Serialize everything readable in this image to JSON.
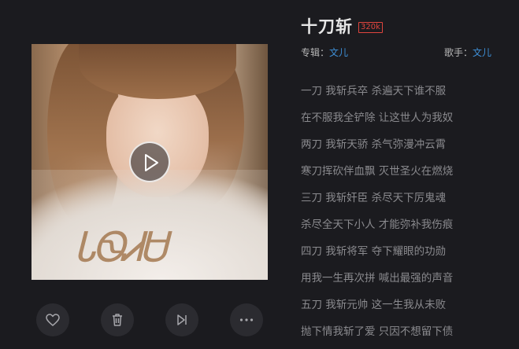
{
  "song": {
    "title": "十刀斩",
    "quality_badge": "320k",
    "album_label": "专辑：",
    "album": "文儿",
    "artist_label": "歌手：",
    "artist": "文儿"
  },
  "lyrics": [
    "一刀 我斩兵卒 杀遍天下谁不服",
    "在不服我全铲除 让这世人为我奴",
    "两刀 我斩天骄 杀气弥漫冲云霄",
    "寒刀挥砍伴血飘 灭世圣火在燃烧",
    "三刀 我斩奸臣 杀尽天下厉鬼魂",
    "杀尽全天下小人 才能弥补我伤痕",
    "四刀 我斩将军 夺下耀眼的功勋",
    "用我一生再次拼 喊出最强的声音",
    "五刀 我斩元帅 这一生我从未败",
    "抛下情我斩了爱 只因不想留下债"
  ],
  "controls": {
    "like_icon": "heart-icon",
    "delete_icon": "trash-icon",
    "next_icon": "skip-next-icon",
    "more_icon": "more-dots-icon",
    "play_icon": "play-icon"
  },
  "colors": {
    "background": "#1b1b1f",
    "accent_link": "#3e8fd6",
    "quality_badge": "#e0453e"
  }
}
